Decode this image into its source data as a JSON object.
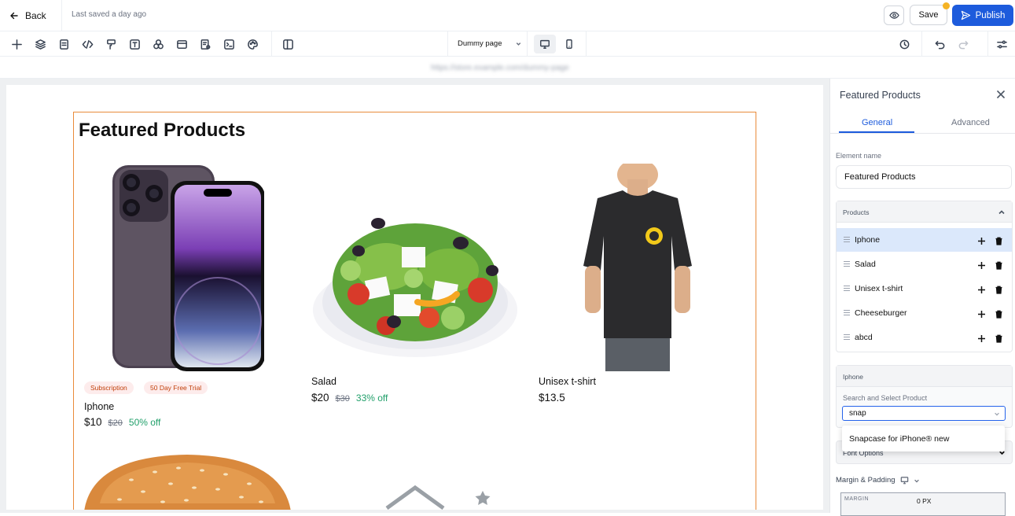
{
  "topbar": {
    "back_label": "Back",
    "saved_status": "Last saved a day ago",
    "save_label": "Save",
    "publish_label": "Publish"
  },
  "toolbar": {
    "tools": [
      "add-icon",
      "layers-icon",
      "page-icon",
      "code-icon",
      "paint-roller-icon",
      "text-icon",
      "shapes-icon",
      "layout-icon",
      "form-icon",
      "terminal-icon",
      "palette-icon",
      "split-view-icon"
    ],
    "page_name": "Dummy page",
    "devices": [
      "desktop",
      "mobile"
    ]
  },
  "url": {
    "value": "https://store.example.com/dummy-page"
  },
  "canvas": {
    "section_title": "Featured Products",
    "products": [
      {
        "name": "Iphone",
        "price": "$10",
        "old_price": "$20",
        "discount": "50% off",
        "badges": [
          "Subscription",
          "50 Day Free Trial"
        ]
      },
      {
        "name": "Salad",
        "price": "$20",
        "old_price": "$30",
        "discount": "33% off"
      },
      {
        "name": "Unisex t-shirt",
        "price": "$13.5"
      }
    ]
  },
  "panel": {
    "title": "Featured Products",
    "tabs": [
      "General",
      "Advanced"
    ],
    "element_name_label": "Element name",
    "element_name_value": "Featured Products",
    "products_label": "Products",
    "product_items": [
      "Iphone",
      "Salad",
      "Unisex t-shirt",
      "Cheeseburger",
      "abcd"
    ],
    "selected_product": "Iphone",
    "search_label": "Search and Select Product",
    "search_value": "snap",
    "dropdown_option": "Snapcase for iPhone® new",
    "font_options_label": "Font Options",
    "margin_padding_label": "Margin & Padding",
    "margin_label": "MARGIN",
    "margin_value": "0 PX"
  },
  "colors": {
    "accent": "#1d5bdc",
    "selection": "#e98b3a",
    "discount": "#22a06b",
    "save_dot": "#f5b324"
  }
}
